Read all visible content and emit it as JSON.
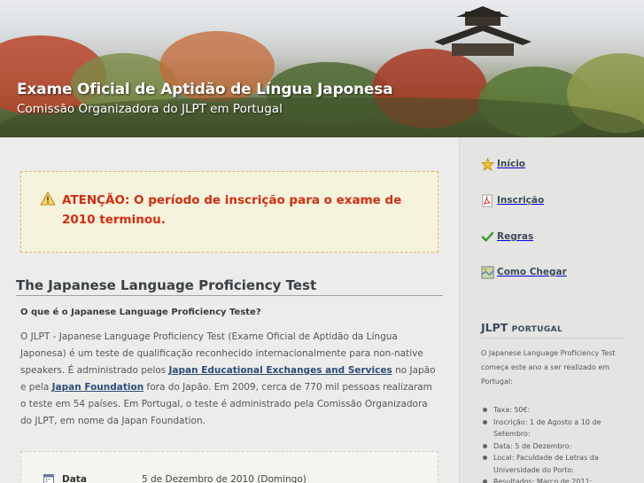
{
  "header": {
    "title": "Exame Oficial de Aptidão de Língua Japonesa",
    "subtitle": "Comissão Organizadora do JLPT em Portugal"
  },
  "alert": {
    "icon": "warning-icon",
    "message": "ATENÇÃO: O período de inscrição para o exame de 2010 terminou."
  },
  "main": {
    "section_title": "The Japanese Language Proficiency Test",
    "question": "O que é o Japanese Language Proficiency Teste?",
    "paragraph": {
      "part1": "O JLPT - Japanese Language Proficiency Test (Exame Oficial de Aptidão da Língua Japonesa) é um teste de qualificação reconhecido internacionalmente para non-native speakers. É administrado pelos ",
      "link1": "Japan Educational Exchanges and Services",
      "part2": " no Japão e pela ",
      "link2": "Japan Foundation",
      "part3": " fora do Japão. Em 2009, cerca de 770 mil pessoas realizaram o teste em 54 países. Em Portugal, o teste é administrado pela Comissão Organizadora do JLPT, em nome da Japan Foundation."
    },
    "info": {
      "date_label": "Data",
      "date_value": "5 de Dezembro de 2010 (Domingo)"
    }
  },
  "sidebar": {
    "nav": [
      {
        "label": "Início",
        "icon": "star-icon"
      },
      {
        "label": "Inscrição",
        "icon": "pdf-icon"
      },
      {
        "label": "Regras",
        "icon": "checkmark-icon"
      },
      {
        "label": "Como Chegar",
        "icon": "map-icon"
      }
    ],
    "box_title_main": "JLPT",
    "box_title_small": "Portugal",
    "box_text": "O Japanese Language Proficiency Test começa este ano a ser realizado em Portugal:",
    "list": [
      "Taxa: 50€:",
      "Inscrição: 1 de Agosto a 10 de Setembro:",
      "Data: 5 de Dezembro:",
      "Local: Faculdade de Letras da Universidade do Porto:",
      "Resultados: Março de 2011:"
    ]
  },
  "colors": {
    "alert_text": "#d52c10",
    "link": "#2c4d7a",
    "nav_text": "#3b4a5a"
  }
}
